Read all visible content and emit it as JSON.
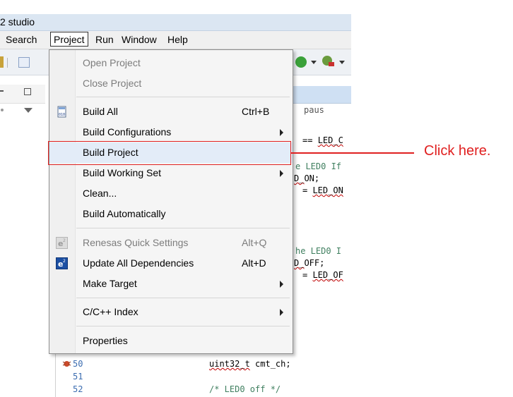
{
  "window": {
    "title": "2 studio"
  },
  "menubar": {
    "items": [
      "Search",
      "Project",
      "Run",
      "Window",
      "Help"
    ]
  },
  "menu": {
    "items": [
      {
        "label": "Open Project",
        "shortcut": "",
        "submenu": false,
        "disabled": true
      },
      {
        "label": "Close Project",
        "shortcut": "",
        "submenu": false,
        "disabled": true
      },
      {
        "label": "Build All",
        "shortcut": "Ctrl+B",
        "submenu": false,
        "disabled": false
      },
      {
        "label": "Build Configurations",
        "shortcut": "",
        "submenu": true,
        "disabled": false
      },
      {
        "label": "Build Project",
        "shortcut": "",
        "submenu": false,
        "disabled": false
      },
      {
        "label": "Build Working Set",
        "shortcut": "",
        "submenu": true,
        "disabled": false
      },
      {
        "label": "Clean...",
        "shortcut": "",
        "submenu": false,
        "disabled": false
      },
      {
        "label": "Build Automatically",
        "shortcut": "",
        "submenu": false,
        "disabled": false
      },
      {
        "label": "Renesas Quick Settings",
        "shortcut": "Alt+Q",
        "submenu": false,
        "disabled": true
      },
      {
        "label": "Update All Dependencies",
        "shortcut": "Alt+D",
        "submenu": false,
        "disabled": false
      },
      {
        "label": "Make Target",
        "shortcut": "",
        "submenu": true,
        "disabled": false
      },
      {
        "label": "C/C++ Index",
        "shortcut": "",
        "submenu": true,
        "disabled": false
      },
      {
        "label": "Properties",
        "shortcut": "",
        "submenu": false,
        "disabled": false
      }
    ]
  },
  "editor": {
    "fragments": {
      "f1": "paus",
      "f2": "== ",
      "f2b": "LED_C",
      "f3": "e LED0 If",
      "f4a": "D_",
      "f4b": "ON;",
      "f5a": "= ",
      "f5b": "LED_ON",
      "f6": "he LED0 I",
      "f7a": "D_",
      "f7b": "OFF;",
      "f8a": "= ",
      "f8b": "LED_OF"
    },
    "lines": [
      {
        "num": "50",
        "code_a": "uint32_t",
        "code_b": " cmt_ch;"
      },
      {
        "num": "51",
        "code_a": "",
        "code_b": ""
      },
      {
        "num": "52",
        "code_a": "/* LED0 off */",
        "code_b": ""
      }
    ]
  },
  "annotation": {
    "text": "Click here.",
    "color": "#e02020"
  },
  "colors": {
    "highlight": "#e02020",
    "comment": "#3f7f5f",
    "line_number": "#3b6cb0"
  }
}
